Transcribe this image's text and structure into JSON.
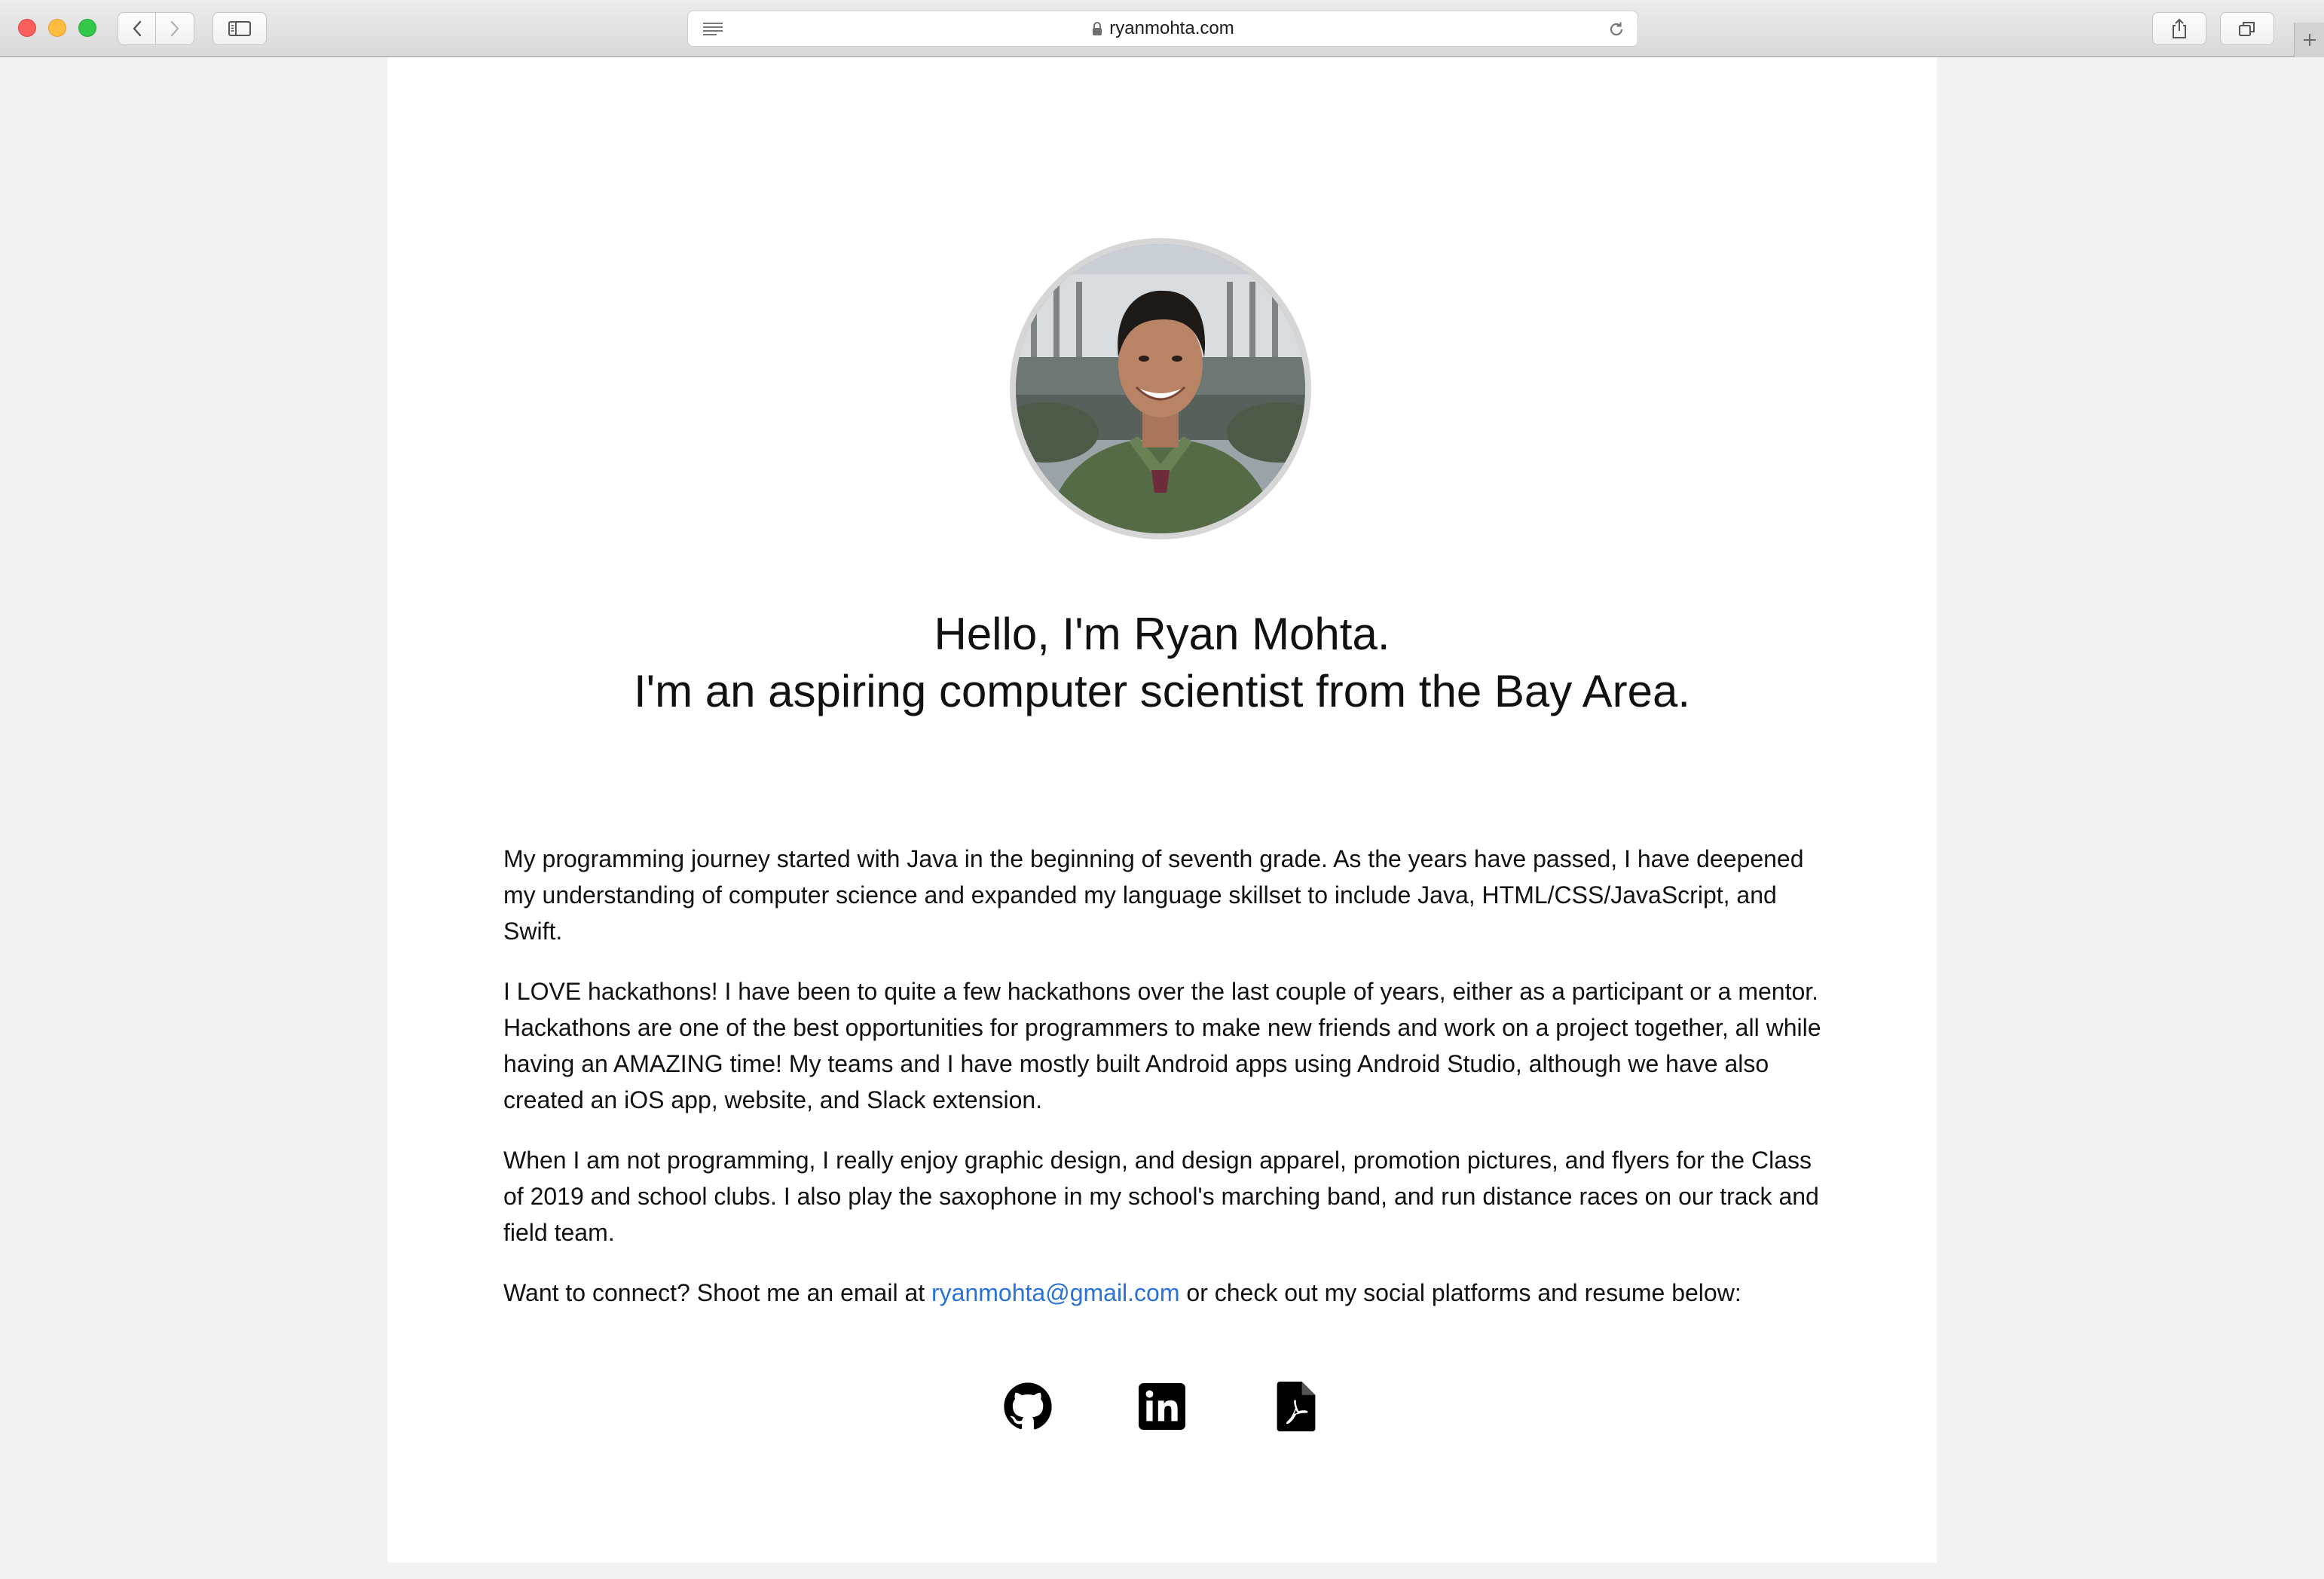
{
  "browser": {
    "url": "ryanmohta.com"
  },
  "profile": {
    "photo_alt": "Ryan Mohta portrait",
    "headline_line1": "Hello, I'm Ryan Mohta.",
    "headline_line2": "I'm an aspiring computer scientist from the Bay Area."
  },
  "bio": {
    "p1": "My programming journey started with Java in the beginning of seventh grade. As the years have passed, I have deepened my understanding of computer science and expanded my language skillset to include Java, HTML/CSS/JavaScript, and Swift.",
    "p2": "I LOVE hackathons! I have been to quite a few hackathons over the last couple of years, either as a participant or a mentor. Hackathons are one of the best opportunities for programmers to make new friends and work on a project together, all while having an AMAZING time! My teams and I have mostly built Android apps using Android Studio, although we have also created an iOS app, website, and Slack extension.",
    "p3": "When I am not programming, I really enjoy graphic design, and design apparel, promotion pictures, and flyers for the Class of 2019 and school clubs. I also play the saxophone in my school's marching band, and run distance races on our track and field team.",
    "contact_prefix": "Want to connect? Shoot me an email at ",
    "email": "ryanmohta@gmail.com",
    "contact_suffix": " or check out my social platforms and resume below:"
  },
  "socials": [
    {
      "icon": "github-icon"
    },
    {
      "icon": "linkedin-icon"
    },
    {
      "icon": "pdf-icon"
    }
  ],
  "colors": {
    "link": "#2a72d6",
    "text": "#111111",
    "page_bg": "#ffffff",
    "outer_bg": "#f2f2f2"
  }
}
